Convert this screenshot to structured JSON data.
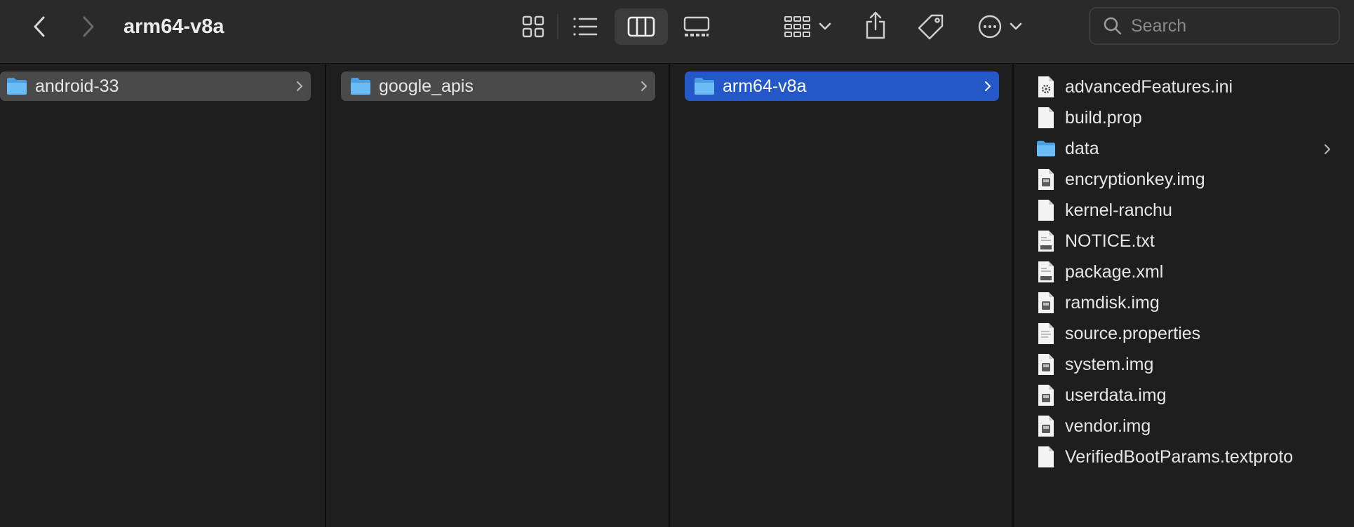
{
  "window": {
    "title": "arm64-v8a",
    "search_placeholder": "Search"
  },
  "toolbar": {
    "icons": [
      "chevron-left-icon",
      "chevron-right-icon",
      "icon-view-icon",
      "list-view-icon",
      "column-view-icon",
      "gallery-view-icon",
      "group-icon",
      "share-icon",
      "tag-icon",
      "more-icon"
    ],
    "active_view": "column"
  },
  "columns": [
    {
      "selected": "android-33",
      "selection_style": "inactive"
    },
    {
      "selected": "google_apis",
      "selection_style": "inactive"
    },
    {
      "selected": "arm64-v8a",
      "selection_style": "active"
    }
  ],
  "files": [
    {
      "name": "advancedFeatures.ini",
      "icon": "settings-file-icon"
    },
    {
      "name": "build.prop",
      "icon": "document-icon"
    },
    {
      "name": "data",
      "icon": "folder-icon",
      "is_folder": true
    },
    {
      "name": "encryptionkey.img",
      "icon": "disk-image-icon"
    },
    {
      "name": "kernel-ranchu",
      "icon": "document-icon"
    },
    {
      "name": "NOTICE.txt",
      "icon": "text-file-icon"
    },
    {
      "name": "package.xml",
      "icon": "xml-file-icon"
    },
    {
      "name": "ramdisk.img",
      "icon": "disk-image-icon"
    },
    {
      "name": "source.properties",
      "icon": "text-document-icon"
    },
    {
      "name": "system.img",
      "icon": "disk-image-icon"
    },
    {
      "name": "userdata.img",
      "icon": "disk-image-icon"
    },
    {
      "name": "vendor.img",
      "icon": "disk-image-icon"
    },
    {
      "name": "VerifiedBootParams.textproto",
      "icon": "document-icon"
    }
  ],
  "colors": {
    "accent": "#2457c8",
    "folder": "#5ab1ef",
    "inactive_selection": "#4a4a4a"
  }
}
